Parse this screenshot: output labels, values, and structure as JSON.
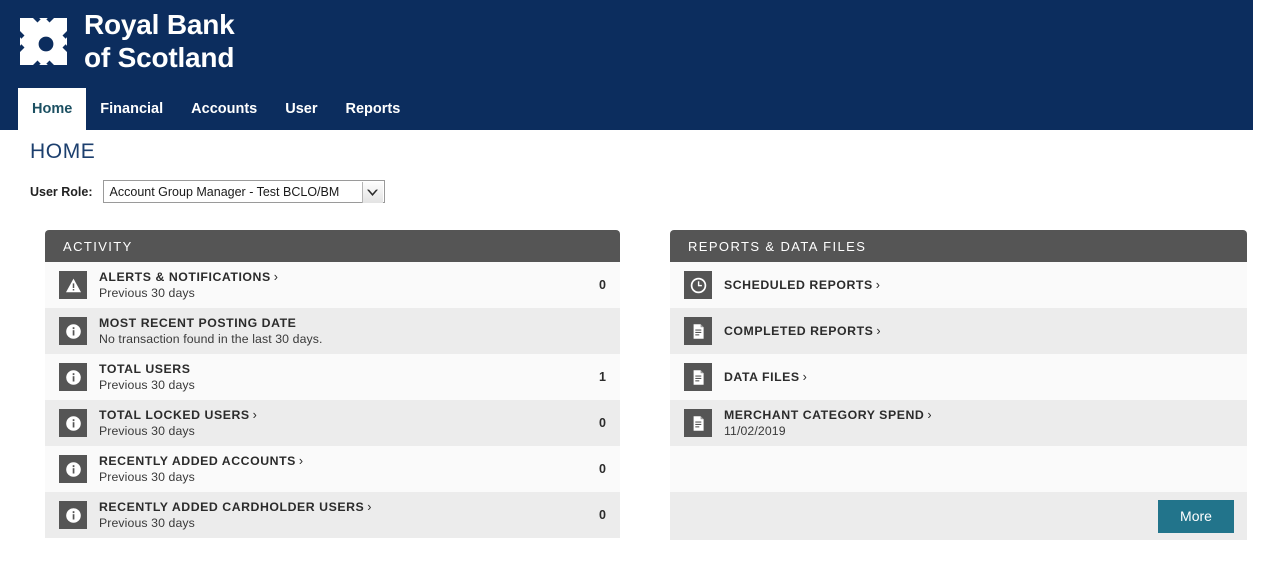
{
  "brand": {
    "line1": "Royal Bank",
    "line2": "of Scotland",
    "logo_icon": "rbs-daisy-wheel-icon",
    "header_color": "#0c2d5e"
  },
  "nav": {
    "tabs": [
      {
        "label": "Home",
        "active": true
      },
      {
        "label": "Financial",
        "active": false
      },
      {
        "label": "Accounts",
        "active": false
      },
      {
        "label": "User",
        "active": false
      },
      {
        "label": "Reports",
        "active": false
      }
    ]
  },
  "page": {
    "title": "HOME"
  },
  "user_role": {
    "label": "User Role:",
    "selected": "Account Group Manager - Test BCLO/BM",
    "arrow_icon": "chevron-down-icon"
  },
  "activity": {
    "header": "ACTIVITY",
    "rows": [
      {
        "icon": "warning-triangle-icon",
        "title": "ALERTS & NOTIFICATIONS",
        "chevron": "›",
        "subtitle": "Previous 30 days",
        "count": "0"
      },
      {
        "icon": "info-circle-icon",
        "title": "MOST RECENT POSTING DATE",
        "chevron": "",
        "subtitle": "No transaction found in the last 30 days.",
        "count": ""
      },
      {
        "icon": "info-circle-icon",
        "title": "TOTAL USERS",
        "chevron": "",
        "subtitle": "Previous 30 days",
        "count": "1"
      },
      {
        "icon": "info-circle-icon",
        "title": "TOTAL LOCKED USERS",
        "chevron": "›",
        "subtitle": "Previous 30 days",
        "count": "0"
      },
      {
        "icon": "info-circle-icon",
        "title": "RECENTLY ADDED ACCOUNTS",
        "chevron": "›",
        "subtitle": "Previous 30 days",
        "count": "0"
      },
      {
        "icon": "info-circle-icon",
        "title": "RECENTLY ADDED CARDHOLDER USERS",
        "chevron": "›",
        "subtitle": "Previous 30 days",
        "count": "0"
      }
    ]
  },
  "reports": {
    "header": "REPORTS & DATA FILES",
    "rows": [
      {
        "icon": "clock-icon",
        "title": "SCHEDULED REPORTS",
        "chevron": "›",
        "subtitle": "",
        "count": ""
      },
      {
        "icon": "document-icon",
        "title": "COMPLETED REPORTS",
        "chevron": "›",
        "subtitle": "",
        "count": ""
      },
      {
        "icon": "document-icon",
        "title": "DATA FILES",
        "chevron": "›",
        "subtitle": "",
        "count": ""
      },
      {
        "icon": "document-icon",
        "title": "MERCHANT CATEGORY SPEND",
        "chevron": "›",
        "subtitle": "11/02/2019",
        "count": ""
      }
    ],
    "more_label": "More",
    "more_color": "#22748b"
  }
}
